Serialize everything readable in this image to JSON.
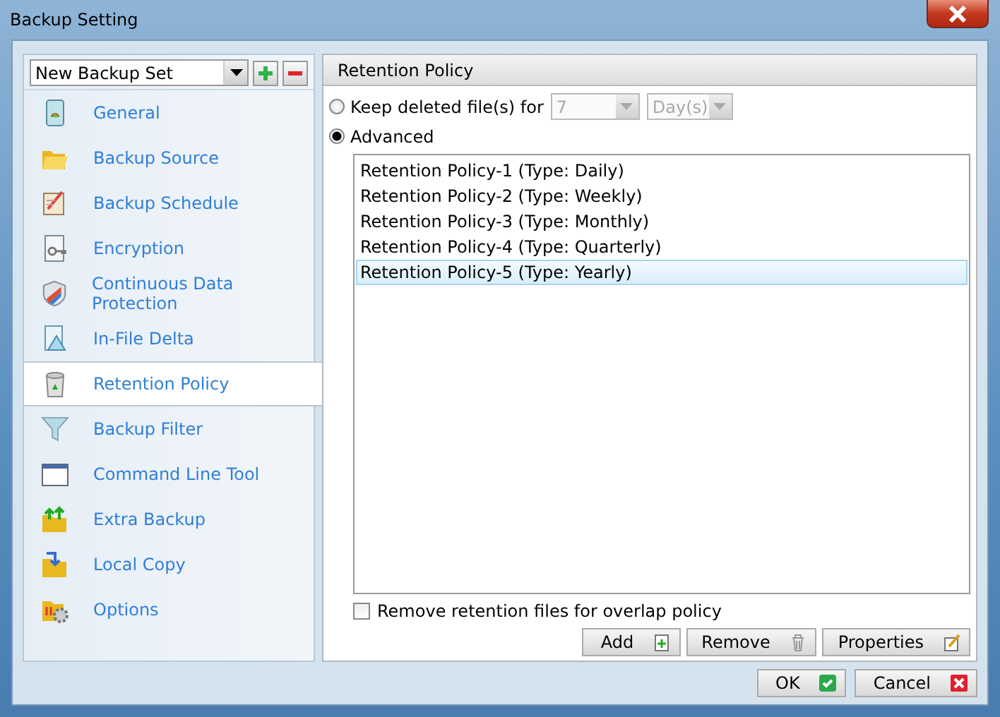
{
  "window": {
    "title": "Backup Setting"
  },
  "backup_set": {
    "value": "New Backup Set"
  },
  "sidebar": {
    "items": [
      {
        "label": "General",
        "selected": false
      },
      {
        "label": "Backup Source",
        "selected": false
      },
      {
        "label": "Backup Schedule",
        "selected": false
      },
      {
        "label": "Encryption",
        "selected": false
      },
      {
        "label": "Continuous Data Protection",
        "selected": false
      },
      {
        "label": "In-File Delta",
        "selected": false
      },
      {
        "label": "Retention Policy",
        "selected": true
      },
      {
        "label": "Backup Filter",
        "selected": false
      },
      {
        "label": "Command Line Tool",
        "selected": false
      },
      {
        "label": "Extra Backup",
        "selected": false
      },
      {
        "label": "Local Copy",
        "selected": false
      },
      {
        "label": "Options",
        "selected": false
      }
    ]
  },
  "panel": {
    "title": "Retention Policy",
    "keep_option": {
      "label": "Keep deleted file(s) for",
      "selected": false,
      "count": "7",
      "unit": "Day(s)",
      "disabled": true
    },
    "advanced_option": {
      "label": "Advanced",
      "selected": true
    },
    "policies": [
      {
        "label": "Retention Policy-1 (Type: Daily)",
        "selected": false
      },
      {
        "label": "Retention Policy-2 (Type: Weekly)",
        "selected": false
      },
      {
        "label": "Retention Policy-3 (Type: Monthly)",
        "selected": false
      },
      {
        "label": "Retention Policy-4 (Type: Quarterly)",
        "selected": false
      },
      {
        "label": "Retention Policy-5 (Type: Yearly)",
        "selected": true
      }
    ],
    "overlap": {
      "label": "Remove retention files for overlap policy",
      "checked": false
    },
    "buttons": [
      "Add",
      "Remove",
      "Properties"
    ]
  },
  "dialog_buttons": [
    "OK",
    "Cancel"
  ]
}
